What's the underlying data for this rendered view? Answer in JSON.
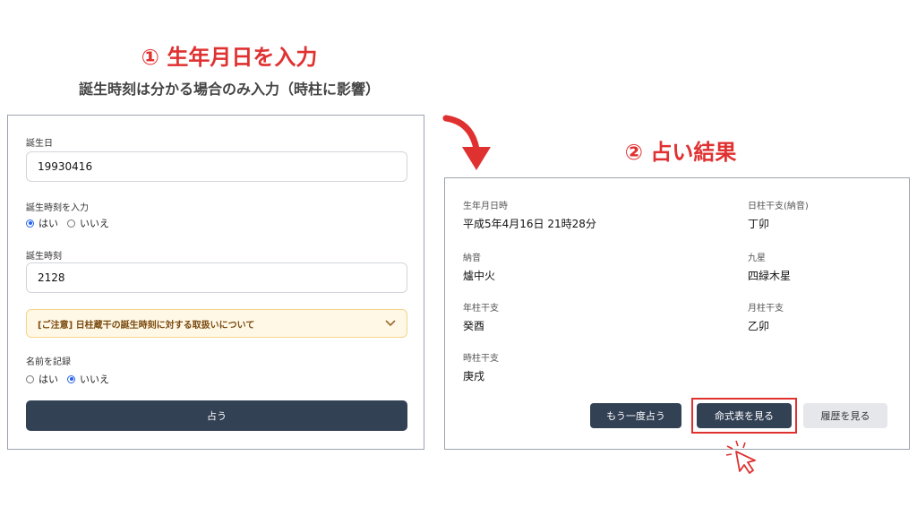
{
  "header": {
    "step1_title": "① 生年月日を入力",
    "step1_subtitle": "誕生時刻は分かる場合のみ入力（時柱に影響）",
    "step2_title": "② 占い結果"
  },
  "form": {
    "birthdate_label": "誕生日",
    "birthdate_value": "19930416",
    "birthtime_toggle_label": "誕生時刻を入力",
    "birthtime_toggle_yes": "はい",
    "birthtime_toggle_no": "いいえ",
    "birthtime_label": "誕生時刻",
    "birthtime_value": "2128",
    "notice_text": "[ご注意] 日柱蔵干の誕生時刻に対する取扱いについて",
    "save_name_label": "名前を記録",
    "save_name_yes": "はい",
    "save_name_no": "いいえ",
    "submit_label": "占う"
  },
  "result": {
    "birth_datetime_label": "生年月日時",
    "birth_datetime_value": "平成5年4月16日 21時28分",
    "day_pillar_label": "日柱干支(納音)",
    "day_pillar_value": "丁卯",
    "nayin_label": "納音",
    "nayin_value": "爐中火",
    "nine_star_label": "九星",
    "nine_star_value": "四緑木星",
    "year_pillar_label": "年柱干支",
    "year_pillar_value": "癸酉",
    "month_pillar_label": "月柱干支",
    "month_pillar_value": "乙卯",
    "hour_pillar_label": "時柱干支",
    "hour_pillar_value": "庚戌",
    "again_button": "もう一度占う",
    "meishiki_button": "命式表を見る",
    "history_button": "履歴を見る"
  },
  "colors": {
    "accent_red": "#e03131",
    "button_dark": "#334155",
    "radio_blue": "#2563eb"
  }
}
